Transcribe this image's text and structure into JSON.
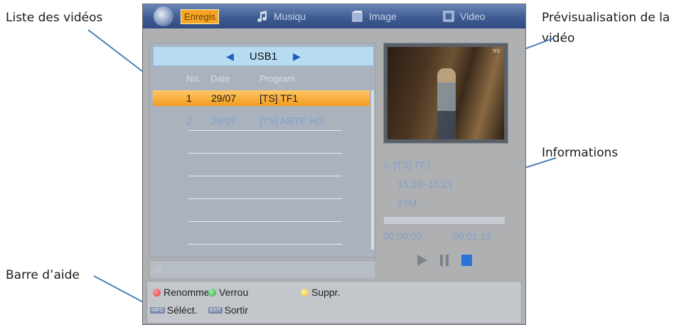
{
  "annotations": {
    "video_list": "Liste des vidéos",
    "preview_line1": "Prévisualisation de la",
    "preview_line2": "vidéo",
    "informations": "Informations",
    "help_bar": "Barre d’aide"
  },
  "tabs": [
    {
      "label": "Enregis",
      "icon": "record-icon",
      "active": true
    },
    {
      "label": "Musiqu",
      "icon": "music-note-icon"
    },
    {
      "label": "Image",
      "icon": "image-icon"
    },
    {
      "label": "Video",
      "icon": "film-icon"
    }
  ],
  "source": {
    "label": "USB1",
    "prev_icon": "arrow-left-icon",
    "next_icon": "arrow-right-icon"
  },
  "columns": {
    "no": "No.",
    "date": "Date",
    "program": "Program."
  },
  "rows": [
    {
      "no": "1",
      "date": "29/07",
      "program": "[TS] TF1",
      "selected": true
    },
    {
      "no": "2",
      "date": "29/07",
      "program": "[TS] ARTE HD",
      "selected": false
    }
  ],
  "page_indicator": "0",
  "preview": {
    "channel_logo": "TF1"
  },
  "info": {
    "title": "[TS] TF1",
    "time_range": "15:20~15:21",
    "size": "27M",
    "elapsed": "00:00:00",
    "total": "00:01:12",
    "progress": 0
  },
  "controls": [
    "play-icon",
    "pause-icon",
    "stop-icon"
  ],
  "help": {
    "rename": "Renomme",
    "lock": "Verrou",
    "delete": "Suppr.",
    "select": "Séléct.",
    "exit": "Sortir",
    "info_key": "INFO",
    "exit_key": "EXIT"
  },
  "colors": {
    "red": "#d83a3a",
    "green": "#2fa84a",
    "yellow": "#f0c233",
    "accent": "#f5a623",
    "list_text": "#7f9fcf"
  }
}
